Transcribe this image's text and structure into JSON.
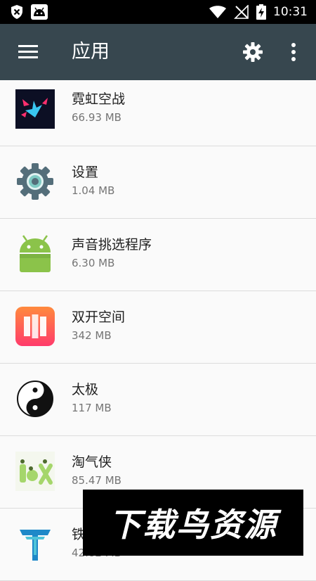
{
  "status_bar": {
    "time": "10:31",
    "icons_left": [
      "shield-x-icon",
      "android-notification-icon"
    ],
    "icons_right": [
      "wifi-icon",
      "no-signal-icon",
      "battery-charging-icon"
    ]
  },
  "toolbar": {
    "title": "应用",
    "menu_icon": "hamburger-icon",
    "settings_icon": "gear-icon",
    "more_icon": "more-vert-icon"
  },
  "apps": [
    {
      "name": "霓虹空战",
      "size": "66.93 MB",
      "icon": "neon-airwar-icon"
    },
    {
      "name": "设置",
      "size": "1.04 MB",
      "icon": "settings-gear-icon"
    },
    {
      "name": "声音挑选程序",
      "size": "6.30 MB",
      "icon": "android-robot-icon"
    },
    {
      "name": "双开空间",
      "size": "342 MB",
      "icon": "dual-space-icon"
    },
    {
      "name": "太极",
      "size": "117 MB",
      "icon": "taiji-yinyang-icon"
    },
    {
      "name": "淘气侠",
      "size": "85.47 MB",
      "icon": "taoqixia-icon"
    },
    {
      "name": "铁",
      "size": "42.82 MB",
      "icon": "t-logo-icon"
    }
  ],
  "watermark": {
    "text": "下载鸟资源"
  },
  "colors": {
    "toolbar": "#37474f",
    "statusbar": "#000000",
    "background": "#fafafa"
  }
}
